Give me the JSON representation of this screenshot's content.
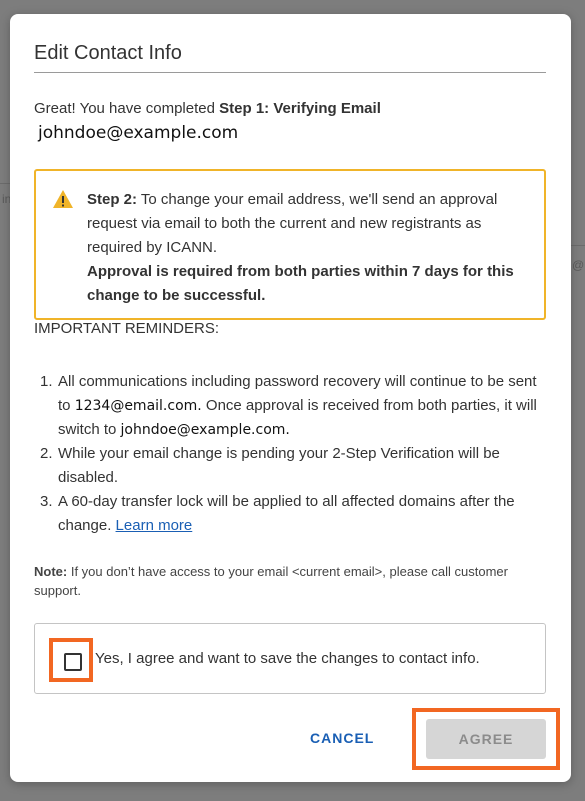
{
  "background": {
    "hint_left": "in",
    "hint_right": "@"
  },
  "modal": {
    "title": "Edit Contact Info",
    "step1_prefix": "Great! You have completed ",
    "step1_bold": "Step 1: Verifying Email",
    "new_email": "johndoe@example.com",
    "alert": {
      "icon": "warning-icon",
      "step2_label": "Step 2:",
      "step2_text": " To change your email address, we'll send an approval request via email to both the current and new registrants as required by ICANN.",
      "step2_bold": "Approval is required from both parties within 7 days for this change to be successful."
    },
    "reminders_title": "IMPORTANT REMINDERS:",
    "reminders": [
      {
        "num": "1.",
        "text_a": "All communications including password recovery will continue to be sent to ",
        "email_a": "1234@email.com.",
        "text_b": " Once approval is received from both parties, it will switch to ",
        "email_b": "johndoe@example.com."
      },
      {
        "num": "2.",
        "text": "While your email change is pending your 2-Step Verification will be disabled."
      },
      {
        "num": "3.",
        "text": "A 60-day transfer lock will be applied to all affected domains after the change. ",
        "link": "Learn more"
      }
    ],
    "note_label": "Note:",
    "note_text": " If you don’t have access to your email <current email>, please call customer support.",
    "agree_checkbox_label": "Yes, I agree and want to save the changes to contact info.",
    "checkbox_checked": false,
    "cancel_label": "CANCEL",
    "agree_label": "AGREE"
  },
  "colors": {
    "accent": "#1a5fb4",
    "warning_border": "#f0b429",
    "highlight": "#f26722"
  }
}
